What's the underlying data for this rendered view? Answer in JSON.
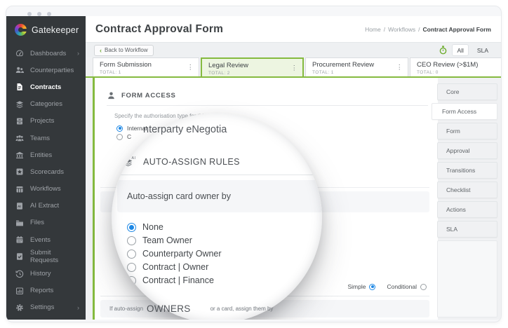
{
  "brand": {
    "name": "Gatekeeper"
  },
  "icons": {
    "kebab_menu": "⋮",
    "chevron_right": "›",
    "chevron_left": "‹",
    "breadcrumb_sep": "/"
  },
  "sidebar": {
    "items": [
      {
        "label": "Dashboards",
        "icon": "gauge-icon",
        "chevron": true,
        "active": false
      },
      {
        "label": "Counterparties",
        "icon": "people-icon",
        "chevron": false,
        "active": false
      },
      {
        "label": "Contracts",
        "icon": "contract-icon",
        "chevron": false,
        "active": true
      },
      {
        "label": "Categories",
        "icon": "layers-icon",
        "chevron": false,
        "active": false
      },
      {
        "label": "Projects",
        "icon": "cabinet-icon",
        "chevron": false,
        "active": false
      },
      {
        "label": "Teams",
        "icon": "teams-icon",
        "chevron": false,
        "active": false
      },
      {
        "label": "Entities",
        "icon": "bank-icon",
        "chevron": false,
        "active": false
      },
      {
        "label": "Scorecards",
        "icon": "star-card-icon",
        "chevron": false,
        "active": false
      },
      {
        "label": "Workflows",
        "icon": "workflow-grid-icon",
        "chevron": false,
        "active": false
      },
      {
        "label": "AI Extract",
        "icon": "ai-document-icon",
        "chevron": false,
        "active": false
      },
      {
        "label": "Files",
        "icon": "folder-icon",
        "chevron": false,
        "active": false
      },
      {
        "label": "Events",
        "icon": "calendar-icon",
        "chevron": false,
        "active": false
      },
      {
        "label": "Submit Requests",
        "icon": "document-check-icon",
        "chevron": false,
        "active": false
      },
      {
        "label": "History",
        "icon": "history-clock-icon",
        "chevron": false,
        "active": false
      },
      {
        "label": "Reports",
        "icon": "bar-chart-icon",
        "chevron": false,
        "active": false
      },
      {
        "label": "Settings",
        "icon": "gear-icon",
        "chevron": true,
        "active": false
      }
    ]
  },
  "header": {
    "title": "Contract Approval Form",
    "breadcrumb": {
      "home": "Home",
      "workflows": "Workflows",
      "current": "Contract Approval Form"
    }
  },
  "toolbar": {
    "back": "Back to Workflow",
    "all": "All",
    "sla": "SLA"
  },
  "phases": [
    {
      "label": "Form Submission",
      "total": "TOTAL: 1",
      "active": false
    },
    {
      "label": "Legal Review",
      "total": "TOTAL: 2",
      "active": true
    },
    {
      "label": "Procurement Review",
      "total": "TOTAL: 1",
      "active": false
    },
    {
      "label": "CEO Review (>$1M)",
      "total": "TOTAL: 0",
      "active": false
    }
  ],
  "form_access": {
    "heading": "FORM ACCESS",
    "description": "Specify the authorisation type for this phase",
    "option_internal": "Internal",
    "magnified_fragment": "nterparty eNegotia",
    "option_partial": "C"
  },
  "auto_assign": {
    "heading": "AUTO-ASSIGN RULES",
    "icon_badge": "AI",
    "box_label": "Auto-assign card owner by",
    "options": [
      {
        "label": "None",
        "selected": true
      },
      {
        "label": "Team Owner",
        "selected": false
      },
      {
        "label": "Counterparty Owner",
        "selected": false
      },
      {
        "label": "Contract | Owner",
        "selected": false
      },
      {
        "label": "Contract | Finance",
        "selected": false
      }
    ]
  },
  "mode": {
    "simple": "Simple",
    "conditional": "Conditional"
  },
  "assign_rule": {
    "prefix": "If auto-assign",
    "magnified": "OWNERS",
    "suffix": "or a card, assign them by"
  },
  "right_tabs": [
    {
      "label": "Core",
      "active": false
    },
    {
      "label": "Form Access",
      "active": true
    },
    {
      "label": "Form",
      "active": false
    },
    {
      "label": "Approval",
      "active": false
    },
    {
      "label": "Transitions",
      "active": false
    },
    {
      "label": "Checklist",
      "active": false
    },
    {
      "label": "Actions",
      "active": false
    },
    {
      "label": "SLA",
      "active": false
    }
  ],
  "colors": {
    "accent_green": "#85ba3f",
    "active_tab_bg": "#edf5e1",
    "radio_blue": "#1e88e5",
    "sidebar_bg": "#34383b"
  }
}
